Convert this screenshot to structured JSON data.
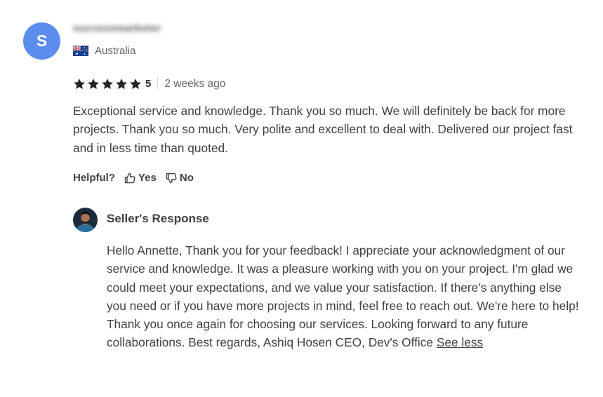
{
  "reviewer": {
    "initial": "S",
    "avatar_color": "#5b8def",
    "username": "successmarketer",
    "country": "Australia",
    "flag_icon": "australia-flag-icon"
  },
  "rating": {
    "stars": 5,
    "score": "5",
    "time_ago": "2 weeks ago",
    "star_icon": "star-icon"
  },
  "review": {
    "text": "Exceptional service and knowledge. Thank you so much. We will definitely be back for more projects. Thank you so much. Very polite and excellent to deal with. Delivered our project fast and in less time than quoted."
  },
  "helpful": {
    "label": "Helpful?",
    "yes_label": "Yes",
    "no_label": "No",
    "yes_icon": "thumbs-up-icon",
    "no_icon": "thumbs-down-icon"
  },
  "seller_response": {
    "title": "Seller's Response",
    "text": "Hello Annette, Thank you for your feedback! I appreciate your acknowledgment of our service and knowledge. It was a pleasure working with you on your project. I'm glad we could meet your expectations, and we value your satisfaction. If there's anything else you need or if you have more projects in mind, feel free to reach out. We're here to help! Thank you once again for choosing our services. Looking forward to any future collaborations. Best regards, Ashiq Hosen CEO, Dev's Office",
    "see_less_label": "See less"
  },
  "colors": {
    "text": "#404145",
    "muted": "#62646a",
    "star": "#222325"
  }
}
